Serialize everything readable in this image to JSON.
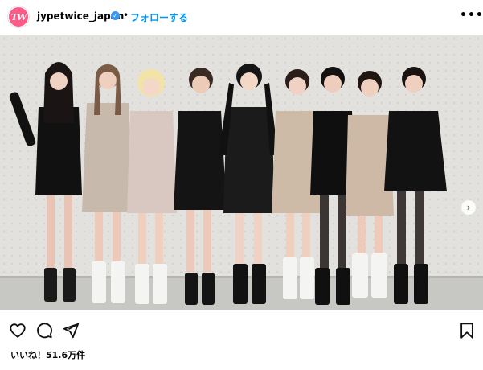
{
  "post": {
    "account": {
      "avatar_text": "TW",
      "username": "jypetwice_japan",
      "verified": true,
      "separator": "•",
      "follow_label": "フォローする"
    },
    "more_icon": "more-horizontal-icon",
    "media": {
      "type": "carousel-photo",
      "slides": 3,
      "active_slide": 1
    },
    "actions": {
      "like_icon": "heart-icon",
      "comment_icon": "comment-icon",
      "share_icon": "share-icon",
      "save_icon": "bookmark-icon"
    },
    "likes_text": "いいね！51.6万件"
  },
  "colors": {
    "accent": "#0095f6",
    "verified": "#3897f0",
    "avatar_bg": "#ff5a87"
  }
}
